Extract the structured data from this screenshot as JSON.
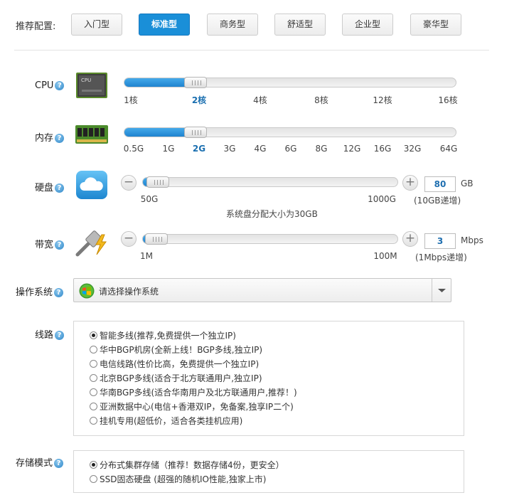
{
  "presets": {
    "label": "推荐配置:",
    "items": [
      "入门型",
      "标准型",
      "商务型",
      "舒适型",
      "企业型",
      "豪华型"
    ],
    "active_index": 1
  },
  "cpu": {
    "label": "CPU",
    "ticks": [
      "1核",
      "2核",
      "4核",
      "8核",
      "12核",
      "16核"
    ],
    "selected": "2核",
    "chip_text": "CPU"
  },
  "memory": {
    "label": "内存",
    "ticks": [
      "0.5G",
      "1G",
      "2G",
      "3G",
      "4G",
      "6G",
      "8G",
      "12G",
      "16G",
      "32G",
      "64G"
    ],
    "selected": "2G"
  },
  "disk": {
    "label": "硬盘",
    "min_label": "50G",
    "max_label": "1000G",
    "value": "80",
    "unit": "GB",
    "step_note": "(10GB递增)",
    "sys_note": "系统盘分配大小为30GB",
    "minus": "−",
    "plus": "+"
  },
  "bandwidth": {
    "label": "带宽",
    "min_label": "1M",
    "max_label": "100M",
    "value": "3",
    "unit": "Mbps",
    "step_note": "(1Mbps递增)",
    "minus": "−",
    "plus": "+"
  },
  "os": {
    "label": "操作系统",
    "placeholder": "请选择操作系统"
  },
  "line": {
    "label": "线路",
    "options": [
      {
        "text": "智能多线(推荐,免费提供一个独立IP)",
        "checked": true
      },
      {
        "text": "华中BGP机房(全新上线！BGP多线,独立IP)",
        "checked": false
      },
      {
        "text": "电信线路(性价比高，免费提供一个独立IP)",
        "checked": false
      },
      {
        "text": "北京BGP多线(适合于北方联通用户,独立IP)",
        "checked": false
      },
      {
        "text": "华南BGP多线(适合华南用户及北方联通用户,推荐！)",
        "checked": false
      },
      {
        "text": "亚洲数据中心(电信+香港双IP，免备案,独享IP二个)",
        "checked": false
      },
      {
        "text": "挂机专用(超低价，适合各类挂机应用)",
        "checked": false
      }
    ]
  },
  "storage": {
    "label": "存储模式",
    "options": [
      {
        "text": "分布式集群存储（推荐！数据存储4份，更安全）",
        "checked": true
      },
      {
        "text": "SSD固态硬盘 (超强的随机IO性能,独家上市)",
        "checked": false
      }
    ]
  },
  "help_glyph": "?",
  "colors": {
    "accent": "#1a8fd8",
    "selected_tick": "#1a6fb0"
  }
}
